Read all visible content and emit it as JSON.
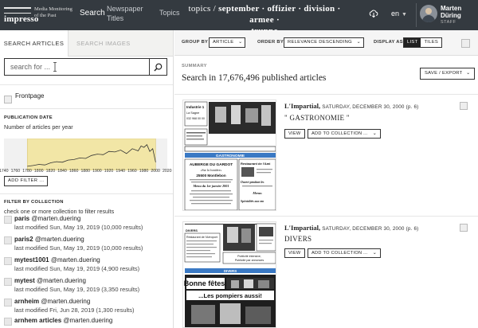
{
  "nav": {
    "brand": "impresso",
    "tagline_1": "Media Monitoring",
    "tagline_2": "of the Past",
    "search": "Search",
    "papers_1": "Newspaper",
    "papers_2": "Titles",
    "topics": "Topics",
    "title_line1_prefix": "topics / ",
    "title_line1_rest": "september · offizier · division · armee ·",
    "title_line2": "truppe",
    "lang": "en",
    "user_first": "Marten",
    "user_last": "Düring",
    "user_role": "STAFF"
  },
  "sidebar": {
    "tab_articles": "SEARCH ARTICLES",
    "tab_images": "SEARCH IMAGES",
    "search_placeholder": "search for ...",
    "frontpage": "Frontpage",
    "pub_date_title": "PUBLICATION DATE",
    "pub_date_sub": "Number of articles per year",
    "histogram": {
      "ticks": [
        "1740",
        "1760",
        "1780",
        "1800",
        "1820",
        "1840",
        "1860",
        "1880",
        "1900",
        "1920",
        "1940",
        "1960",
        "1980",
        "2000",
        "2020"
      ],
      "range_start": 1780,
      "range_end": 2000,
      "x_min": 1740,
      "x_max": 2020,
      "profile": [
        [
          1780,
          0.15
        ],
        [
          1790,
          0.18
        ],
        [
          1800,
          0.22
        ],
        [
          1810,
          0.2
        ],
        [
          1820,
          0.28
        ],
        [
          1830,
          0.32
        ],
        [
          1840,
          0.3
        ],
        [
          1850,
          0.38
        ],
        [
          1860,
          0.4
        ],
        [
          1870,
          0.46
        ],
        [
          1880,
          0.44
        ],
        [
          1890,
          0.55
        ],
        [
          1900,
          0.6
        ],
        [
          1910,
          0.58
        ],
        [
          1920,
          0.7
        ],
        [
          1930,
          0.68
        ],
        [
          1940,
          0.75
        ],
        [
          1950,
          0.62
        ],
        [
          1960,
          0.8
        ],
        [
          1970,
          0.72
        ],
        [
          1975,
          0.9
        ],
        [
          1980,
          0.85
        ],
        [
          1985,
          0.95
        ],
        [
          1990,
          0.7
        ],
        [
          1995,
          0.8
        ],
        [
          2000,
          0.3
        ]
      ]
    },
    "add_filter": "ADD FILTER ...",
    "filter_title": "FILTER BY COLLECTION",
    "filter_sub": "check one or more collection to filter results",
    "collections": [
      {
        "name": "paris",
        "owner": "@marten.duering",
        "modified": "last modified Sun, May 19, 2019 (10,000 results)"
      },
      {
        "name": "paris2",
        "owner": "@marten.duering",
        "modified": "last modified Sun, May 19, 2019 (10,000 results)"
      },
      {
        "name": "mytest1001",
        "owner": "@marten.duering",
        "modified": "last modified Sun, May 19, 2019 (4,900 results)"
      },
      {
        "name": "mytest",
        "owner": "@marten.duering",
        "modified": "last modified Sun, May 19, 2019 (3,350 results)"
      },
      {
        "name": "arnheim",
        "owner": "@marten.duering",
        "modified": "last modified Fri, Jun 28, 2019 (1,300 results)"
      },
      {
        "name": "arnhem articles",
        "owner": "@marten.duering",
        "modified": ""
      }
    ]
  },
  "toolbar": {
    "group_by_label": "GROUP BY",
    "group_by_value": "ARTICLE",
    "order_by_label": "ORDER BY",
    "order_by_value": "RELEVANCE DESCENDING",
    "display_as_label": "DISPLAY AS",
    "display_list": "LIST",
    "display_tiles": "TILES"
  },
  "summary": {
    "label": "SUMMARY",
    "text": "Search in 17,676,496 published articles",
    "save_export": "SAVE / EXPORT"
  },
  "results": [
    {
      "paper": "L'Impartial,",
      "date": "SATURDAY, DECEMBER 30, 2000 (p. 6)",
      "heading": "\" GASTRONOMIE \"",
      "view": "VIEW",
      "add": "ADD TO COLLECTION ..."
    },
    {
      "paper": "L'Impartial,",
      "date": "SATURDAY, DECEMBER 30, 2000 (p. 6)",
      "heading": "DIVERS",
      "view": "VIEW",
      "add": "ADD TO COLLECTION ..."
    }
  ],
  "thumb1_texts": {
    "t1": "Industrie 1",
    "t2": "La Sagne",
    "t3": "032 968 00 00",
    "banner": "GASTRONOMIE",
    "a1": "AUBERGE DU GARDOT",
    "a2": "«Sur la frontière»",
    "a3": "25500 Montlebon",
    "a4": "Menu du 1er janvier 2001",
    "b1": "Restaurant de l'Ami",
    "b2": "Ouvert pendant les",
    "b3": "Menus",
    "b4": "Spécialités aux mo"
  },
  "thumb2_texts": {
    "d1": "DIVERS",
    "d2": "Restaurant de l'Aéroport",
    "d3": "Publicité intensive,",
    "d4": "Publicité par annonces",
    "d5": "DIVERS",
    "bonne": "Bonne fêtes!",
    "pompiers": "...Les pompiers aussi!"
  },
  "colors": {
    "nav_bg": "#343a40",
    "histogram_highlight": "#f2e6a6",
    "histogram_line": "#333333"
  }
}
